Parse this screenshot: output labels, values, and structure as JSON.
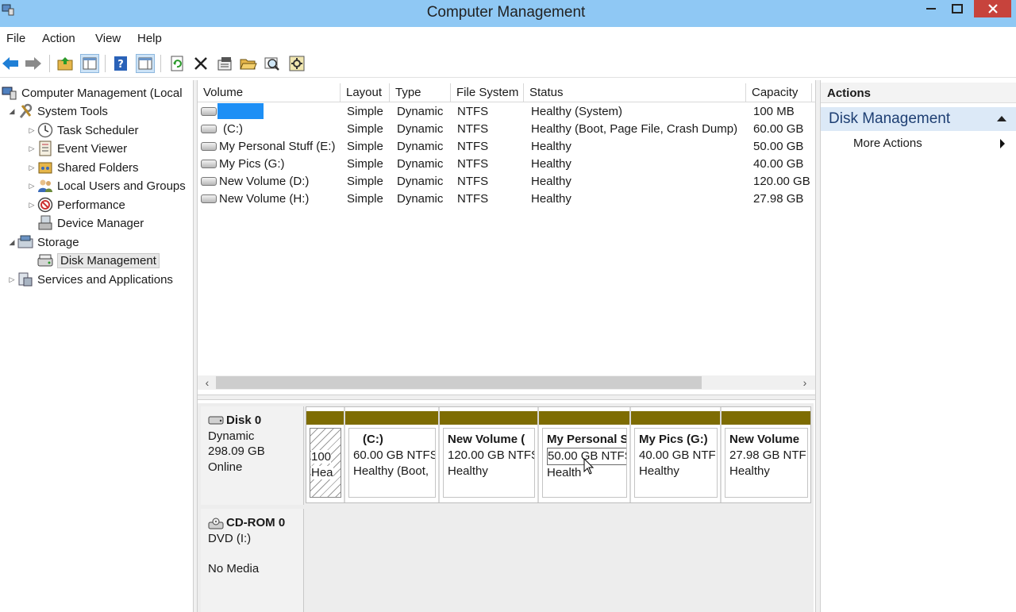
{
  "window": {
    "title": "Computer Management"
  },
  "menu": [
    "File",
    "Action",
    "View",
    "Help"
  ],
  "toolbar_icons": [
    "back-arrow-icon",
    "forward-arrow-icon",
    "up-folder-icon",
    "show-hide-tree-icon",
    "help-icon",
    "console-view-icon",
    "rescan-icon",
    "delete-icon",
    "properties-icon",
    "open-icon",
    "search-icon",
    "settings-icon"
  ],
  "tree": [
    {
      "label": "Computer Management (Local",
      "icon": "computer-management-icon"
    },
    {
      "label": "System Tools",
      "icon": "system-tools-icon"
    },
    {
      "label": "Task Scheduler",
      "icon": "task-scheduler-icon"
    },
    {
      "label": "Event Viewer",
      "icon": "event-viewer-icon"
    },
    {
      "label": "Shared Folders",
      "icon": "shared-folders-icon"
    },
    {
      "label": "Local Users and Groups",
      "icon": "local-users-icon"
    },
    {
      "label": "Performance",
      "icon": "performance-icon"
    },
    {
      "label": "Device Manager",
      "icon": "device-manager-icon"
    },
    {
      "label": "Storage",
      "icon": "storage-icon"
    },
    {
      "label": "Disk Management",
      "icon": "disk-management-icon"
    },
    {
      "label": "Services and Applications",
      "icon": "services-icon"
    }
  ],
  "columns": [
    "Volume",
    "Layout",
    "Type",
    "File System",
    "Status",
    "Capacity"
  ],
  "volumes": [
    {
      "volume": "",
      "layout": "Simple",
      "type": "Dynamic",
      "fs": "NTFS",
      "status": "Healthy (System)",
      "capacity": "100 MB"
    },
    {
      "volume": "(C:)",
      "layout": "Simple",
      "type": "Dynamic",
      "fs": "NTFS",
      "status": "Healthy (Boot, Page File, Crash Dump)",
      "capacity": "60.00 GB"
    },
    {
      "volume": "My Personal Stuff (E:)",
      "layout": "Simple",
      "type": "Dynamic",
      "fs": "NTFS",
      "status": "Healthy",
      "capacity": "50.00 GB"
    },
    {
      "volume": "My Pics (G:)",
      "layout": "Simple",
      "type": "Dynamic",
      "fs": "NTFS",
      "status": "Healthy",
      "capacity": "40.00 GB"
    },
    {
      "volume": "New Volume (D:)",
      "layout": "Simple",
      "type": "Dynamic",
      "fs": "NTFS",
      "status": "Healthy",
      "capacity": "120.00 GB"
    },
    {
      "volume": "New Volume (H:)",
      "layout": "Simple",
      "type": "Dynamic",
      "fs": "NTFS",
      "status": "Healthy",
      "capacity": "27.98 GB"
    }
  ],
  "disk0": {
    "name": "Disk 0",
    "kind": "Dynamic",
    "size": "298.09 GB",
    "state": "Online",
    "partitions": [
      {
        "title": "",
        "line1": "100",
        "line2": "Hea"
      },
      {
        "title": "(C:)",
        "line1": "60.00 GB NTFS",
        "line2": "Healthy (Boot,"
      },
      {
        "title": "New Volume (",
        "line1": "120.00 GB NTFS",
        "line2": "Healthy"
      },
      {
        "title": "My Personal S",
        "line1": "50.00 GB NTFS",
        "line2": "Health"
      },
      {
        "title": "My Pics  (G:)",
        "line1": "40.00 GB NTF:",
        "line2": "Healthy"
      },
      {
        "title": "New Volume",
        "line1": "27.98 GB NTF:",
        "line2": "Healthy"
      }
    ]
  },
  "cdrom": {
    "name": "CD-ROM 0",
    "kind": "DVD (I:)",
    "state": "No Media"
  },
  "actions": {
    "header": "Actions",
    "section": "Disk Management",
    "more": "More Actions"
  },
  "colors": {
    "titlebar": "#8fc8f4",
    "close": "#c7433c",
    "partition_bar": "#7e6c02",
    "section_bg": "#dce9f7",
    "selection": "#1e8ff5"
  }
}
